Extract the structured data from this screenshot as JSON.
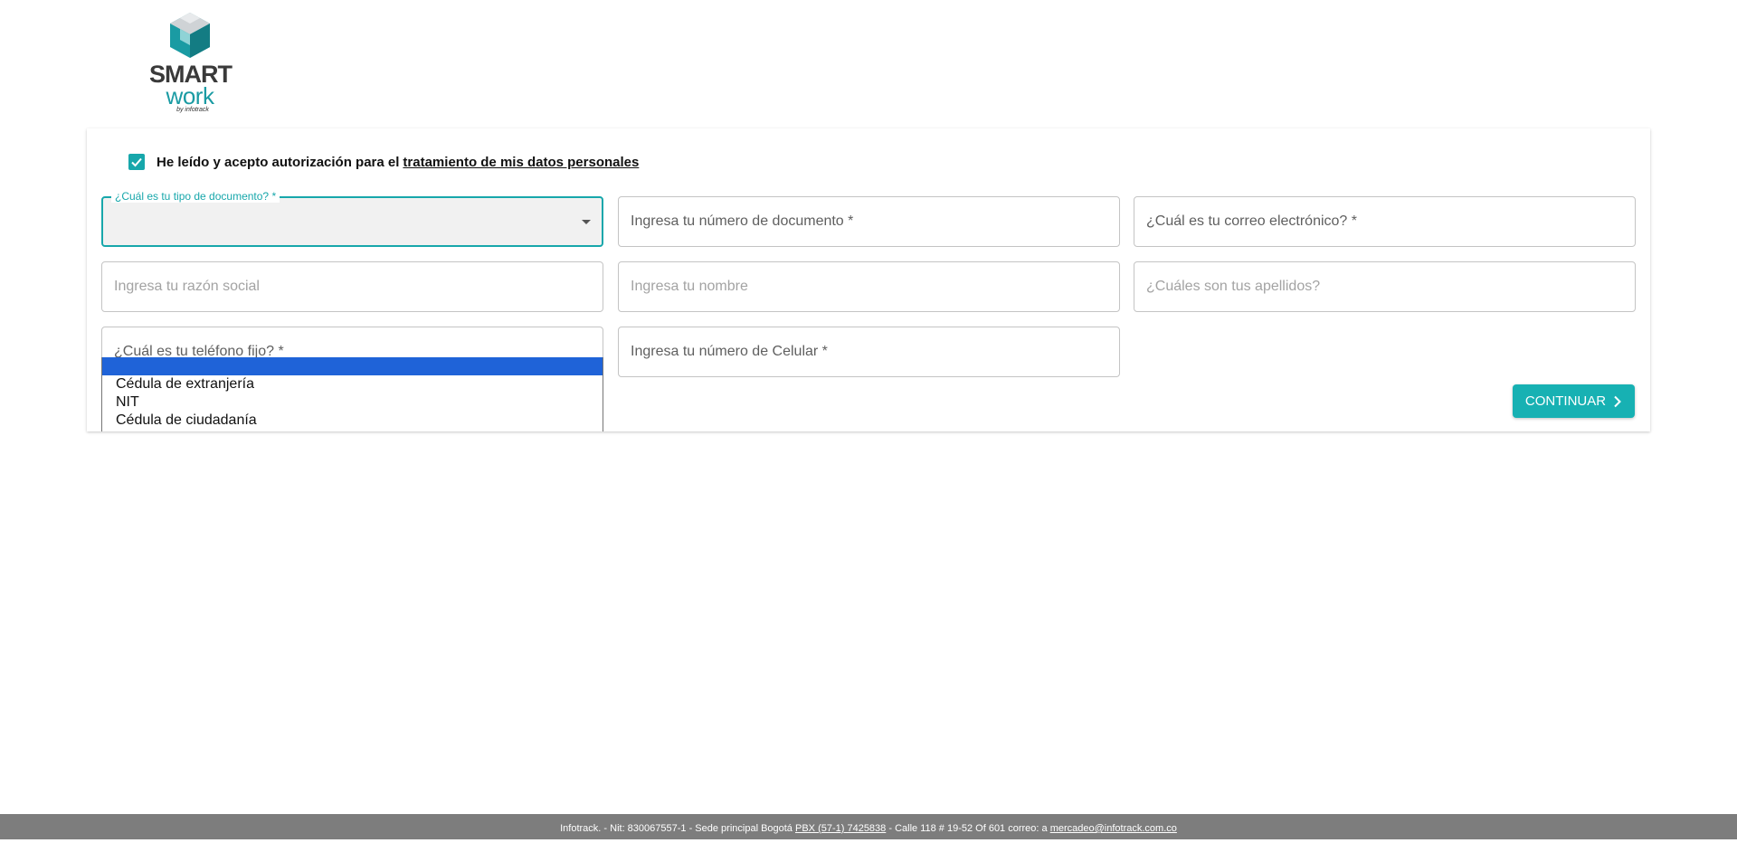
{
  "logo": {
    "brand_top": "SMART",
    "brand_bottom": "work",
    "by_line": "by infotrack"
  },
  "consent": {
    "label": "He leído y acepto autorización para el",
    "link": "tratamiento de mis datos personales",
    "checked": true
  },
  "form": {
    "doc_type": {
      "label": "¿Cuál es tu tipo de documento? *",
      "value": ""
    },
    "doc_number": {
      "placeholder": "Ingresa tu número de documento *"
    },
    "email": {
      "placeholder": "¿Cuál es tu correo electrónico? *"
    },
    "business_name": {
      "placeholder": "Ingresa tu razón social"
    },
    "first_name": {
      "placeholder": "Ingresa tu nombre"
    },
    "last_names": {
      "placeholder": "¿Cuáles son tus apellidos?"
    },
    "landline": {
      "placeholder": "¿Cuál es tu teléfono fijo? *"
    },
    "mobile": {
      "placeholder": "Ingresa tu número de Celular *"
    }
  },
  "dropdown": {
    "options": [
      "",
      "Cédula de extranjería",
      "NIT",
      "Cédula de ciudadanía"
    ]
  },
  "continue_button": {
    "label": "CONTINUAR",
    "icon": "chevron-right-icon"
  },
  "footer": {
    "company": "Infotrack. - Nit: 830067557-1 - Sede principal Bogotá",
    "phone": "PBX (57-1) 7425838",
    "address": "- Calle 118 # 19-52 Of 601   correo: a",
    "email": "mercadeo@infotrack.com.co"
  },
  "colors": {
    "accent": "#17a7ab",
    "selected_option": "#1f63d8",
    "footer_bg": "#7d7d7d"
  }
}
